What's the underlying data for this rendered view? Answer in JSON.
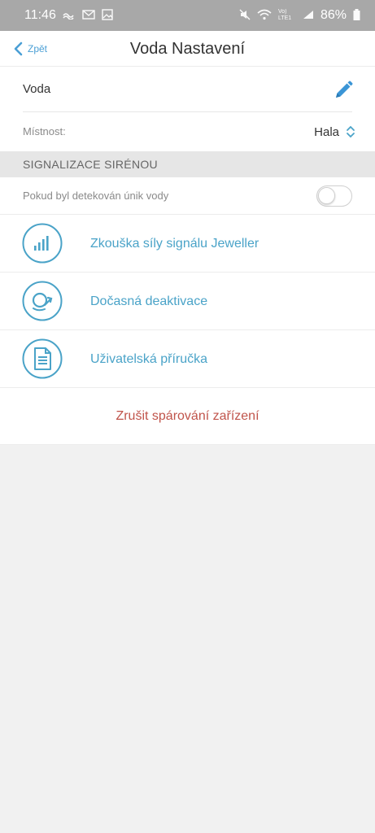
{
  "status_bar": {
    "time": "11:46",
    "battery": "86%",
    "icons": [
      "wave-icon",
      "envelope-icon",
      "image-icon",
      "mute-icon",
      "wifi-icon",
      "volte-icon",
      "signal-icon",
      "battery-icon"
    ],
    "volte": "Vo) LTE1"
  },
  "header": {
    "back_label": "Zpět",
    "title": "Voda Nastavení"
  },
  "device": {
    "name": "Voda",
    "room_label": "Místnost:",
    "room_value": "Hala"
  },
  "siren_section": {
    "title": "SIGNALIZACE SIRÉNOU",
    "toggle_label": "Pokud byl detekován únik vody",
    "toggle_on": false
  },
  "actions": [
    {
      "label": "Zkouška síly signálu Jeweller",
      "icon": "signal-bars-icon"
    },
    {
      "label": "Dočasná deaktivace",
      "icon": "deactivate-icon"
    },
    {
      "label": "Uživatelská příručka",
      "icon": "document-icon"
    }
  ],
  "unpair_label": "Zrušit spárování zařízení",
  "colors": {
    "accent": "#4aa3c8",
    "link_blue": "#4a9fd5",
    "danger": "#c0544b",
    "status_bar": "#a8a8a8"
  }
}
